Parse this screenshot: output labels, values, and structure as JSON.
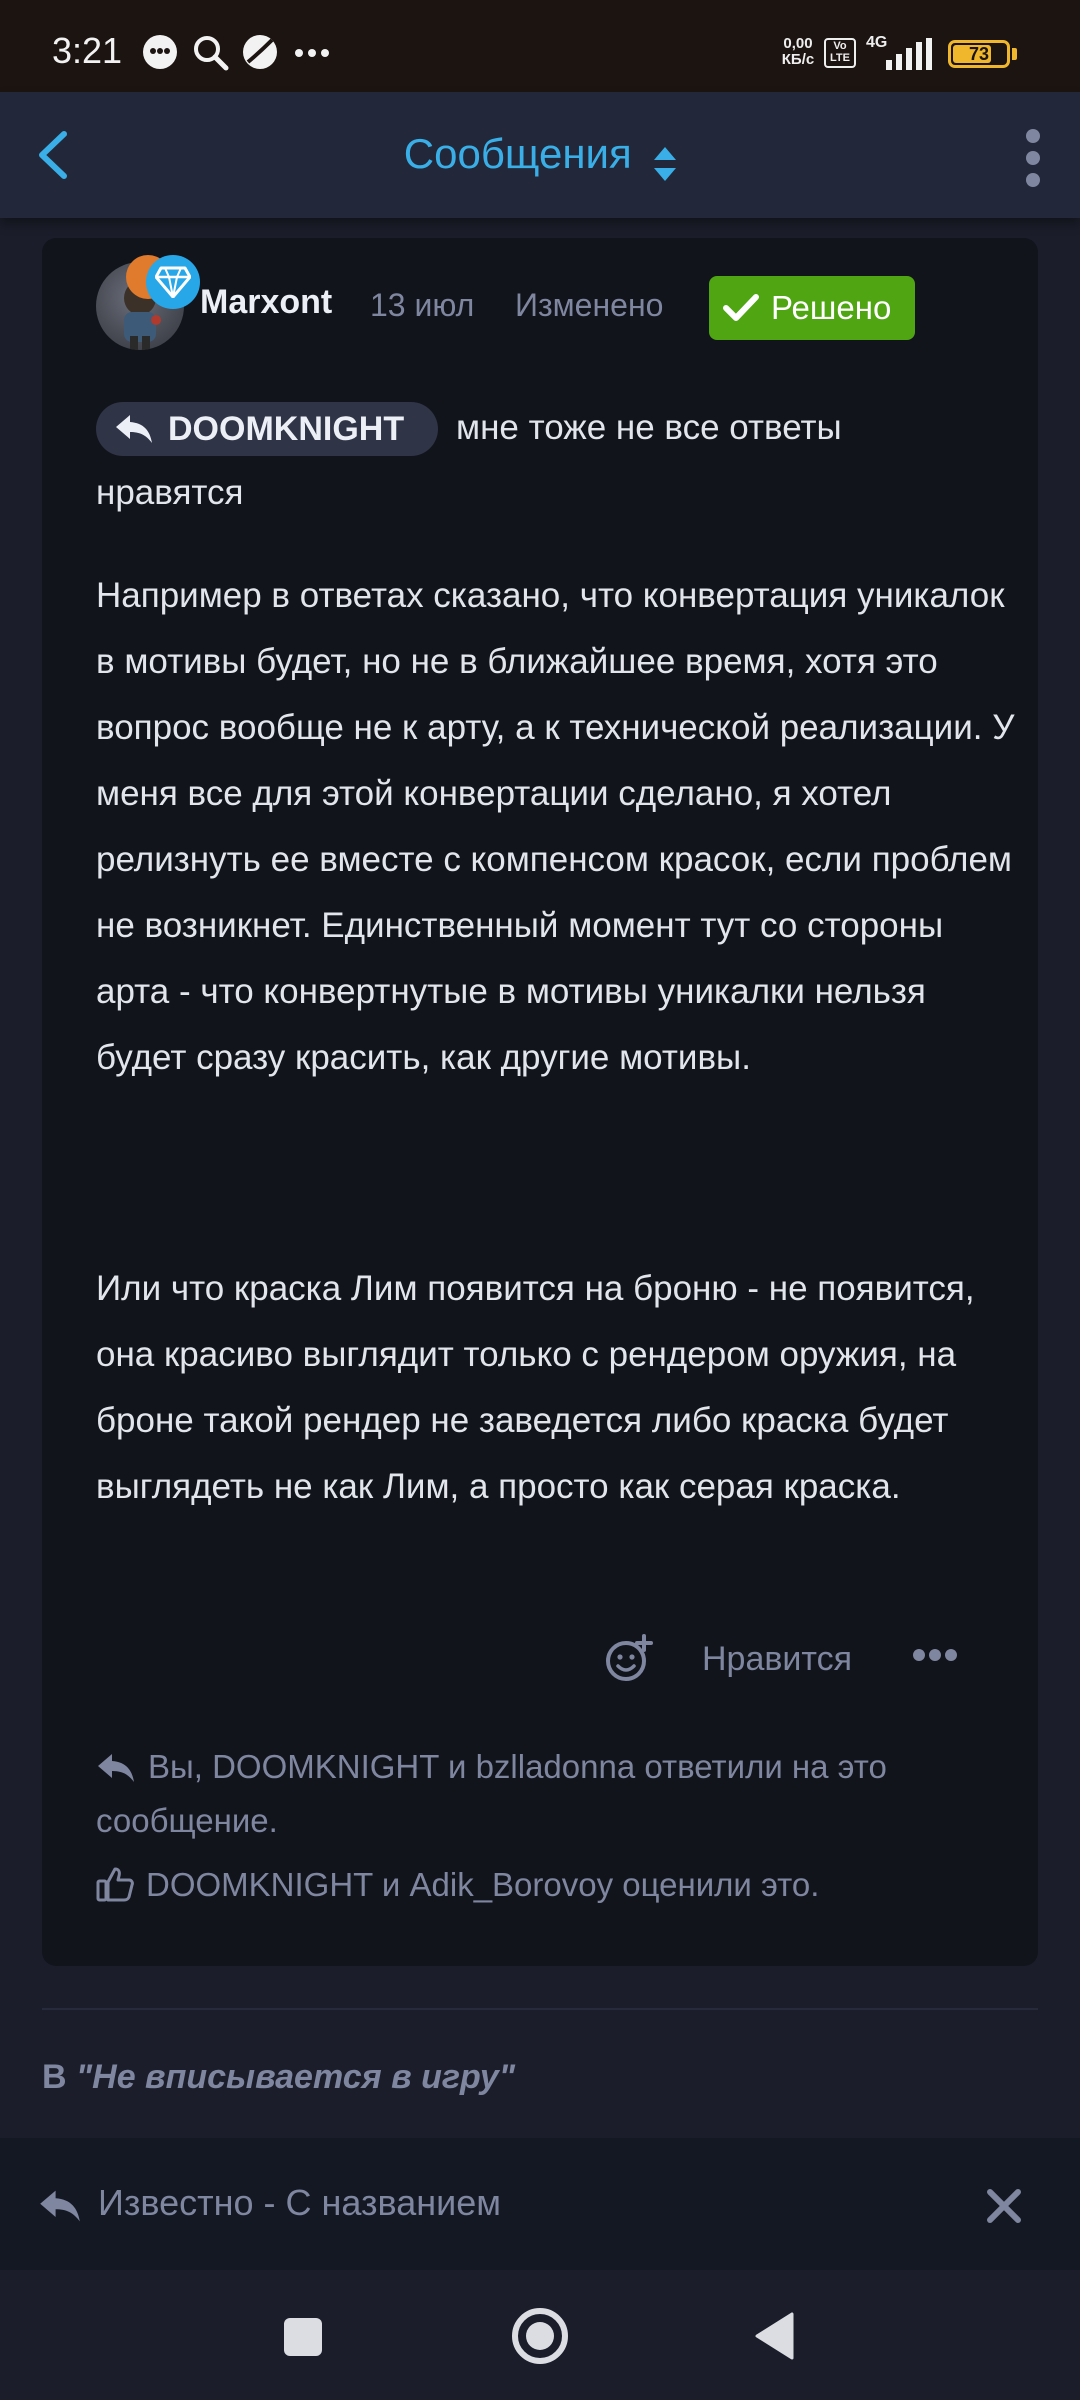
{
  "status_bar": {
    "time": "3:21",
    "net_speed_line1": "0,00",
    "net_speed_line2": "КБ/с",
    "volte_line1": "Vo",
    "volte_line2": "LTE",
    "network": "4G",
    "battery_level": 73,
    "battery_text": "73",
    "icons": [
      "chat-bubble-icon",
      "search-icon",
      "ball-icon",
      "more-dots-icon",
      "signal-icon"
    ]
  },
  "header": {
    "title": "Сообщения",
    "back_icon": "chevron-left-icon",
    "sort_icon": "sort-updown-icon",
    "menu_icon": "kebab-menu-icon",
    "accent": "#3aaee6"
  },
  "post": {
    "author": "Marxont",
    "date": "13 июл",
    "edited": "Изменено",
    "solved_label": "Решено",
    "solved_color": "#4fa512",
    "quote_user": "DOOMKNIGHT",
    "lead_line_1": "мне тоже не все ответы",
    "lead_line_2": "нравятся",
    "paragraph_2": "Например в ответах сказано, что конвертация уникалок в мотивы будет, но не в ближайшее время, хотя это вопрос вообще не к арту, а к технической реализации. У меня все для этой конвертации сделано, я хотел релизнуть ее вместе с компенсом красок, если проблем не возникнет. Единственный момент тут со стороны арта - что конвертнутые в мотивы уникалки нельзя будет сразу красить, как другие мотивы.",
    "paragraph_3": "Или что краска Лим появится на броню - не появится, она красиво выглядит только с рендером оружия, на броне такой рендер не заведется либо краска будет выглядеть не как Лим, а просто как серая краска.",
    "like_label": "Нравится",
    "replied_text": "Вы, DOOMKNIGHT и bzlladonna ответили на это сообщение.",
    "liked_text": "DOOMKNIGHT и Adik_Borovoy оценили это."
  },
  "thread": {
    "prefix": "В",
    "name": "\"Не вписывается в игру\""
  },
  "reply_bar": {
    "label": "Известно - С названием"
  },
  "nav": {
    "recents_icon": "square-icon",
    "home_icon": "circle-home-icon",
    "back_icon": "triangle-back-icon"
  }
}
